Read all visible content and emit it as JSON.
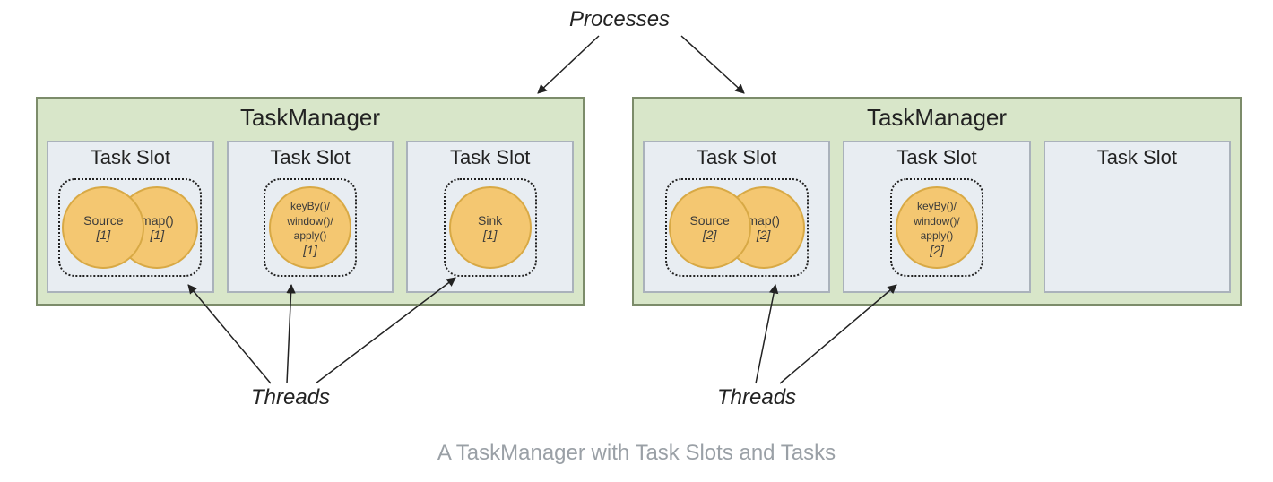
{
  "labels": {
    "processes": "Processes",
    "threads_left": "Threads",
    "threads_right": "Threads"
  },
  "managers": [
    {
      "title": "TaskManager",
      "slots": [
        {
          "title": "Task Slot",
          "tasks": [
            {
              "name": "Source",
              "index": "[1]"
            },
            {
              "name": "map()",
              "index": "[1]"
            }
          ]
        },
        {
          "title": "Task Slot",
          "tasks": [
            {
              "name": "keyBy()/\nwindow()/\napply()",
              "index": "[1]"
            }
          ]
        },
        {
          "title": "Task Slot",
          "tasks": [
            {
              "name": "Sink",
              "index": "[1]"
            }
          ]
        }
      ]
    },
    {
      "title": "TaskManager",
      "slots": [
        {
          "title": "Task Slot",
          "tasks": [
            {
              "name": "Source",
              "index": "[2]"
            },
            {
              "name": "map()",
              "index": "[2]"
            }
          ]
        },
        {
          "title": "Task Slot",
          "tasks": [
            {
              "name": "keyBy()/\nwindow()/\napply()",
              "index": "[2]"
            }
          ]
        },
        {
          "title": "Task Slot",
          "tasks": []
        }
      ]
    }
  ],
  "caption": "A TaskManager with Task Slots and Tasks"
}
